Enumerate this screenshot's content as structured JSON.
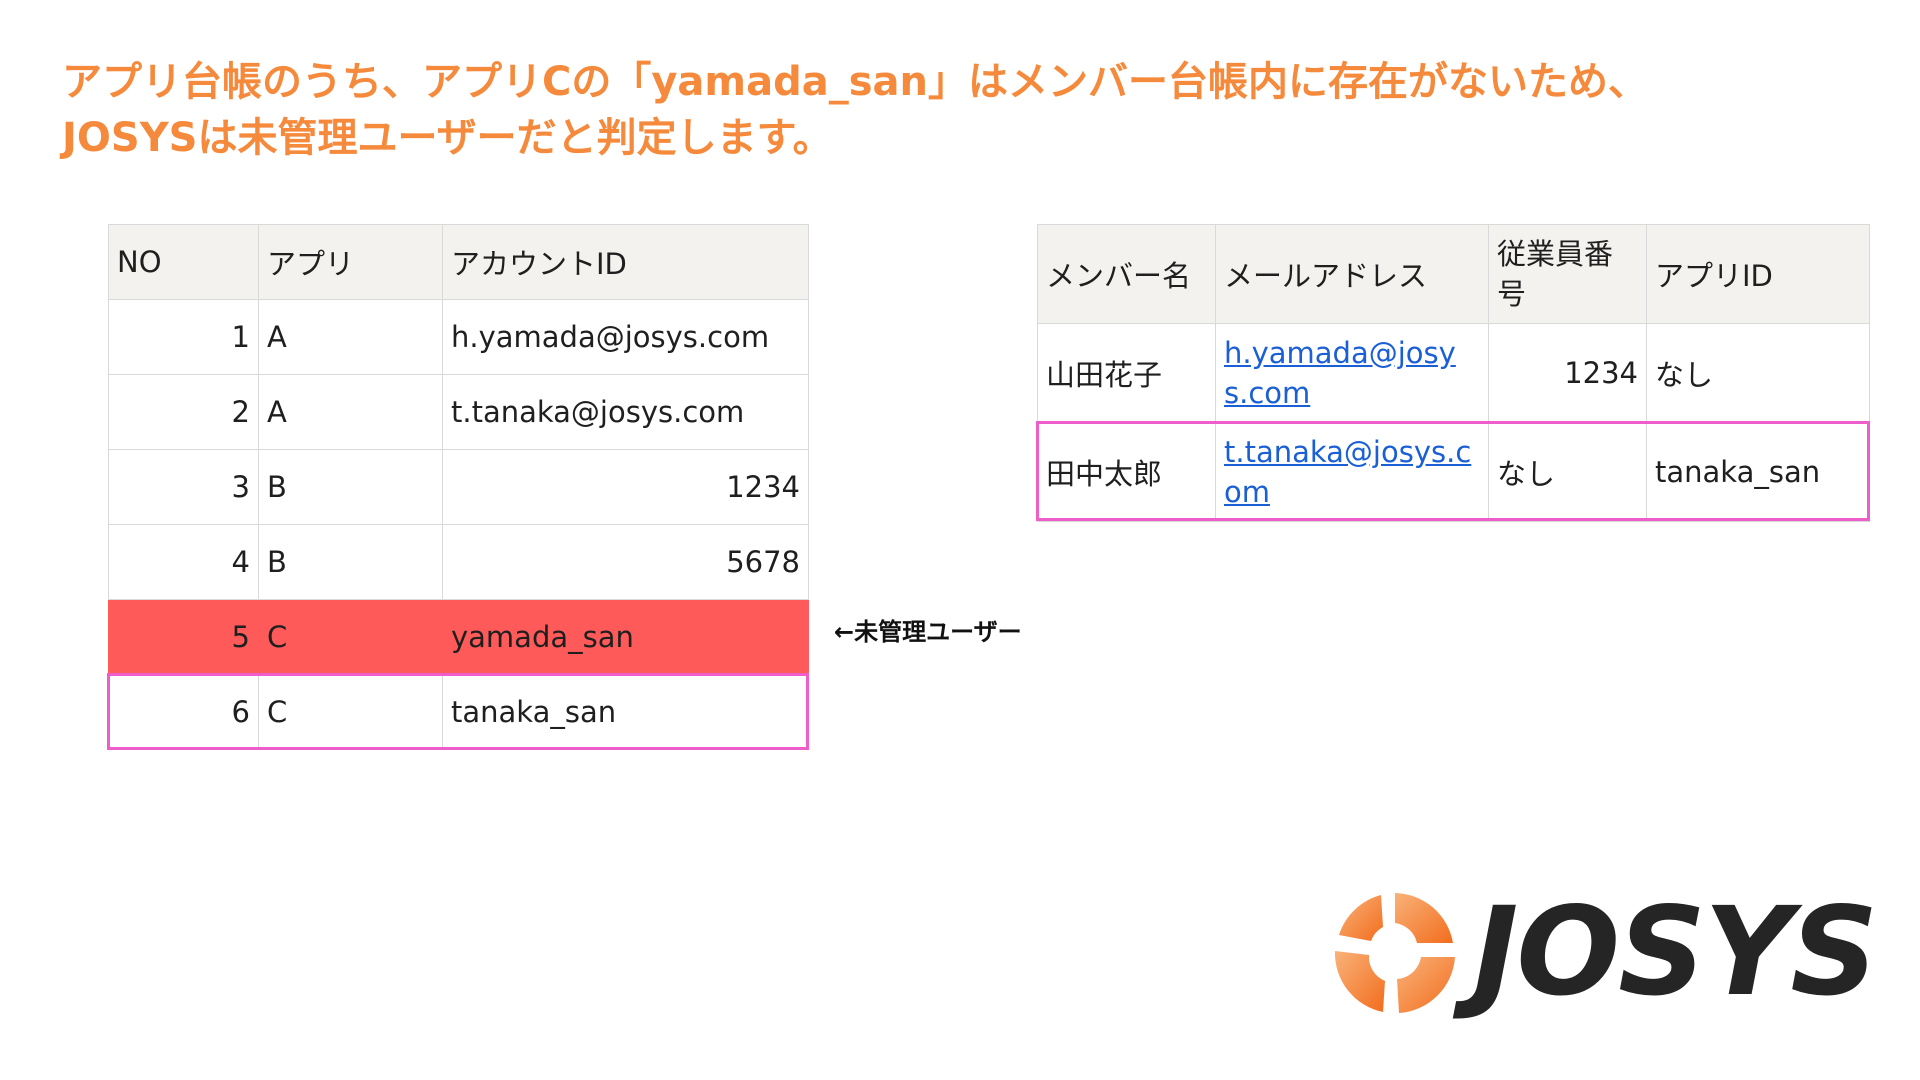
{
  "headline": {
    "line1": "アプリ台帳のうち、アプリCの「yamada_san」はメンバー台帳内に存在がないため、",
    "line2": "JOSYSは未管理ユーザーだと判定します。"
  },
  "app_table": {
    "headers": [
      "NO",
      "アプリ",
      "アカウントID"
    ],
    "rows": [
      {
        "no": "1",
        "app": "A",
        "account": "h.yamada@josys.com"
      },
      {
        "no": "2",
        "app": "A",
        "account": "t.tanaka@josys.com"
      },
      {
        "no": "3",
        "app": "B",
        "account": "1234"
      },
      {
        "no": "4",
        "app": "B",
        "account": "5678"
      },
      {
        "no": "5",
        "app": "C",
        "account": "yamada_san"
      },
      {
        "no": "6",
        "app": "C",
        "account": "tanaka_san"
      }
    ]
  },
  "member_table": {
    "headers": [
      "メンバー名",
      "メールアドレス",
      "従業員番号",
      "アプリID"
    ],
    "rows": [
      {
        "name": "山田花子",
        "email": "h.yamada@josys.com",
        "employee_no": "1234",
        "app_id": "なし"
      },
      {
        "name": "田中太郎",
        "email": "t.tanaka@josys.com",
        "employee_no": "なし",
        "app_id": "tanaka_san"
      }
    ]
  },
  "annotation": "←未管理ユーザー",
  "logo": {
    "text": "JOSYS",
    "colors": {
      "orange": "#f58a3c",
      "dark": "#252525"
    }
  },
  "colors": {
    "headline": "#f58a3c",
    "highlight_row": "#ff5a5a",
    "frame": "#ee5dc9",
    "header_bg": "#f4f2ef",
    "link": "#1a5fd6"
  }
}
